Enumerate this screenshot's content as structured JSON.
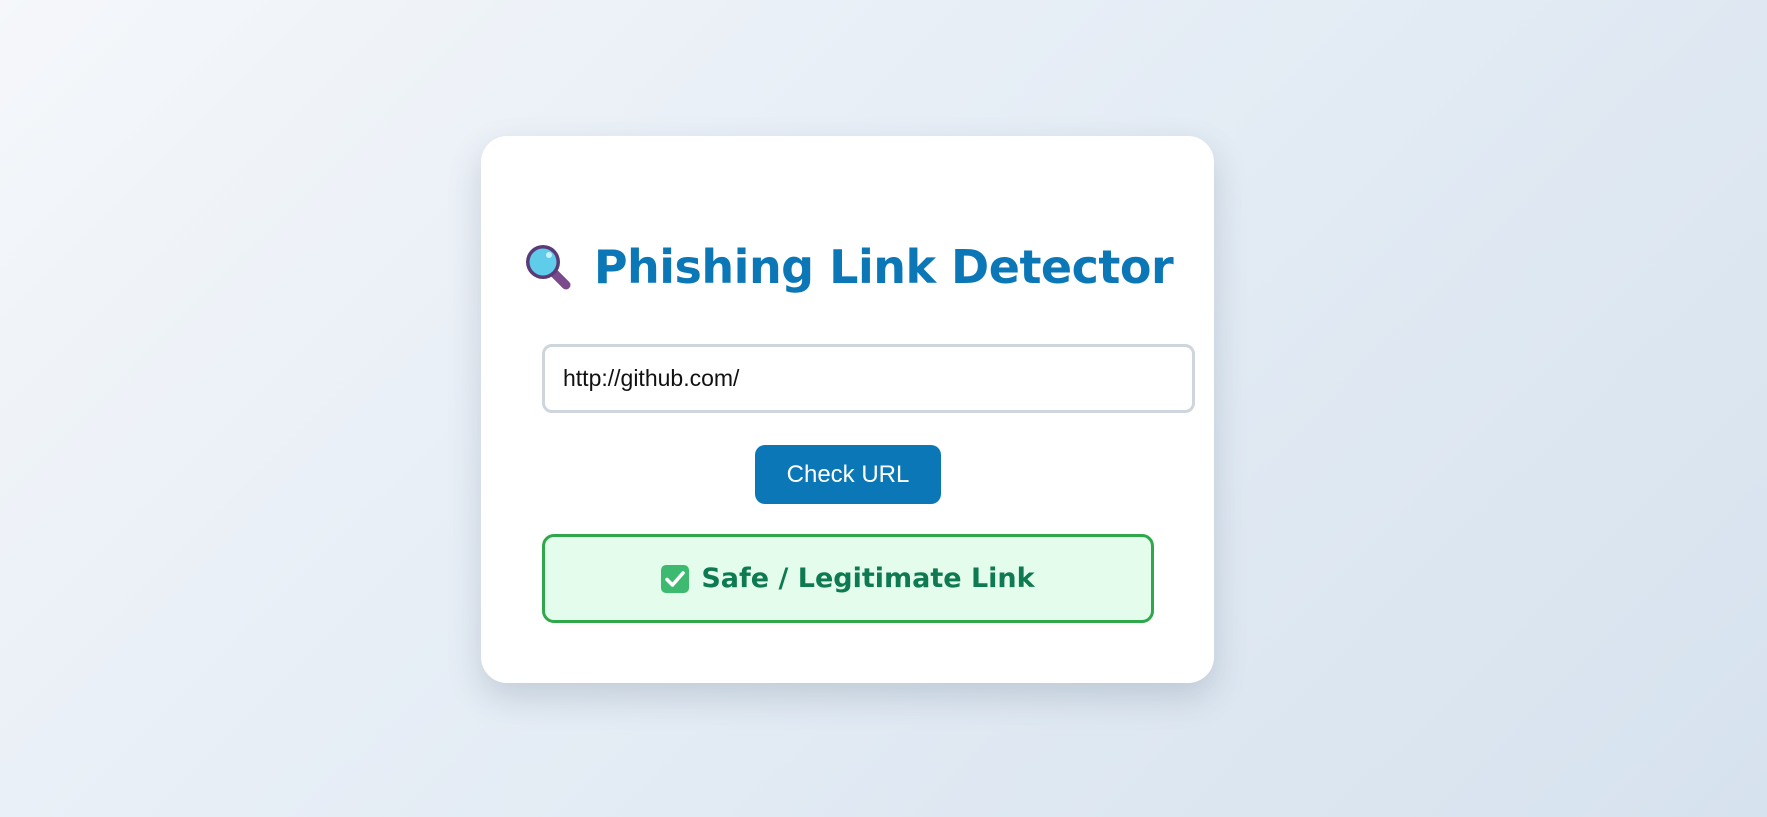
{
  "header": {
    "title": "Phishing Link Detector",
    "icon": "magnifying-glass-icon"
  },
  "url_input": {
    "value": "http://github.com/",
    "placeholder": ""
  },
  "check_button": {
    "label": "Check URL"
  },
  "result": {
    "icon": "check-mark-icon",
    "text": "Safe / Legitimate Link",
    "status": "safe"
  },
  "colors": {
    "accent": "#0b77b6",
    "safe_border": "#2ea84a",
    "safe_background": "#e3fcec",
    "safe_text": "#0e7a52"
  }
}
